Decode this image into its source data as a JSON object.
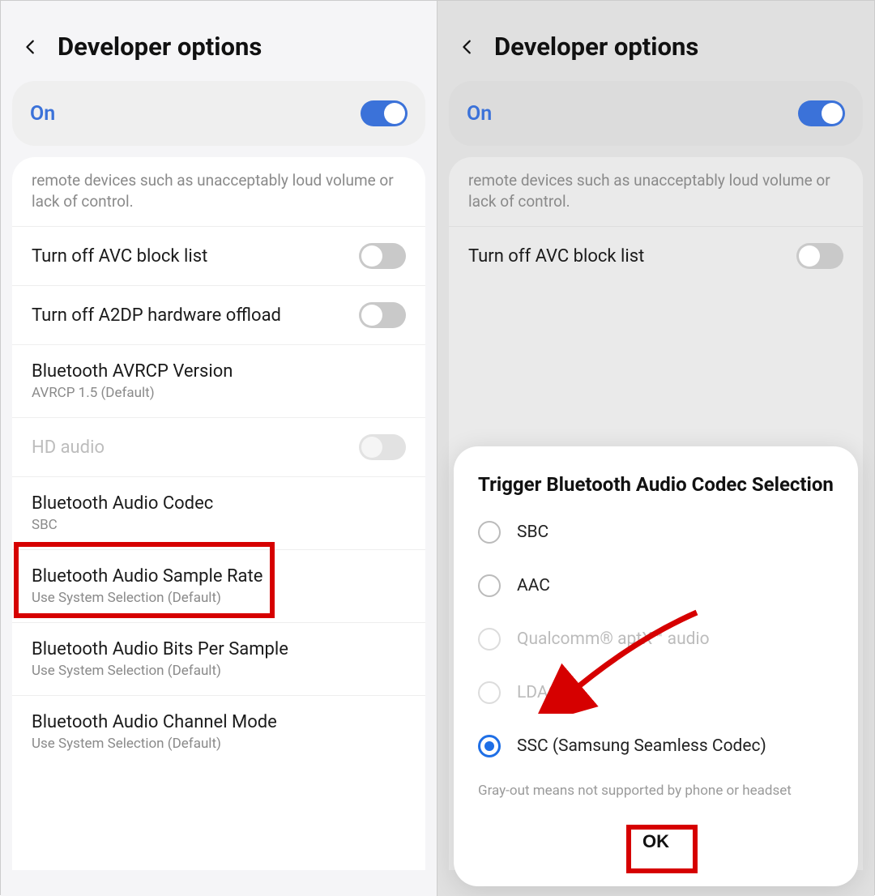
{
  "left": {
    "title": "Developer options",
    "master": {
      "label": "On",
      "checked": true
    },
    "desc": "remote devices such as unacceptably loud volume or lack of control.",
    "items": [
      {
        "title": "Turn off AVC block list",
        "sub": "",
        "toggle": "off"
      },
      {
        "title": "Turn off A2DP hardware offload",
        "sub": "",
        "toggle": "off"
      },
      {
        "title": "Bluetooth AVRCP Version",
        "sub": "AVRCP 1.5 (Default)"
      },
      {
        "title": "HD audio",
        "sub": "",
        "toggle": "disabled",
        "disabled": true
      },
      {
        "title": "Bluetooth Audio Codec",
        "sub": "SBC",
        "highlight": true
      },
      {
        "title": "Bluetooth Audio Sample Rate",
        "sub": "Use System Selection (Default)"
      },
      {
        "title": "Bluetooth Audio Bits Per Sample",
        "sub": "Use System Selection (Default)"
      },
      {
        "title": "Bluetooth Audio Channel Mode",
        "sub": "Use System Selection (Default)"
      }
    ]
  },
  "right": {
    "title": "Developer options",
    "master": {
      "label": "On",
      "checked": true
    },
    "desc": "remote devices such as unacceptably loud volume or lack of control.",
    "items": [
      {
        "title": "Turn off AVC block list",
        "sub": "",
        "toggle": "off"
      }
    ],
    "modal": {
      "title": "Trigger Bluetooth Audio Codec Selection",
      "options": [
        {
          "label": "SBC",
          "state": "unselected"
        },
        {
          "label": "AAC",
          "state": "unselected"
        },
        {
          "label": "Qualcomm® aptX™ audio",
          "state": "disabled"
        },
        {
          "label": "LDAC",
          "state": "disabled"
        },
        {
          "label": "SSC (Samsung Seamless Codec)",
          "state": "selected"
        }
      ],
      "note": "Gray-out means not supported by phone or headset",
      "ok": "OK"
    }
  },
  "annotations": {
    "highlight_color": "#d60000"
  }
}
